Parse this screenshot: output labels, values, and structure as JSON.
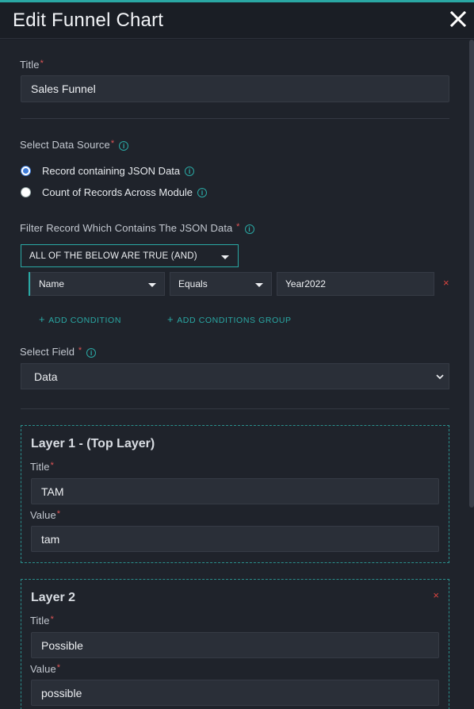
{
  "dialog": {
    "title": "Edit Funnel Chart"
  },
  "title_field": {
    "label": "Title",
    "required_mark": "*",
    "value": "Sales Funnel"
  },
  "data_source": {
    "label": "Select Data Source",
    "required_mark": "*",
    "options": [
      {
        "label": "Record containing JSON Data",
        "selected": true
      },
      {
        "label": "Count of Records Across Module",
        "selected": false
      }
    ]
  },
  "filter": {
    "label": "Filter Record Which Contains The JSON Data",
    "required_mark": "*",
    "logic_selected": "ALL OF THE BELOW ARE TRUE (AND)",
    "condition": {
      "field": "Name",
      "operator": "Equals",
      "value": "Year2022",
      "delete_icon": "×"
    },
    "add_condition": "ADD CONDITION",
    "add_group": "ADD CONDITIONS GROUP",
    "plus": "+"
  },
  "select_field": {
    "label": "Select Field",
    "required_mark": "*",
    "value": "Data"
  },
  "layers": [
    {
      "heading": "Layer 1 - (Top Layer)",
      "title_label": "Title",
      "title_value": "TAM",
      "value_label": "Value",
      "value_value": "tam",
      "deletable": false
    },
    {
      "heading": "Layer 2",
      "title_label": "Title",
      "title_value": "Possible",
      "value_label": "Value",
      "value_value": "possible",
      "deletable": true,
      "delete_icon": "×"
    }
  ],
  "colors": {
    "accent": "#2aa8a4",
    "danger": "#d9443f",
    "background": "#1f232b",
    "input": "#2a2f38",
    "radio_selected": "#3d7bd9"
  },
  "icons": {
    "close": "close-icon",
    "info": "info-icon",
    "caret": "caret-down-icon",
    "chevron": "chevron-down-icon"
  }
}
